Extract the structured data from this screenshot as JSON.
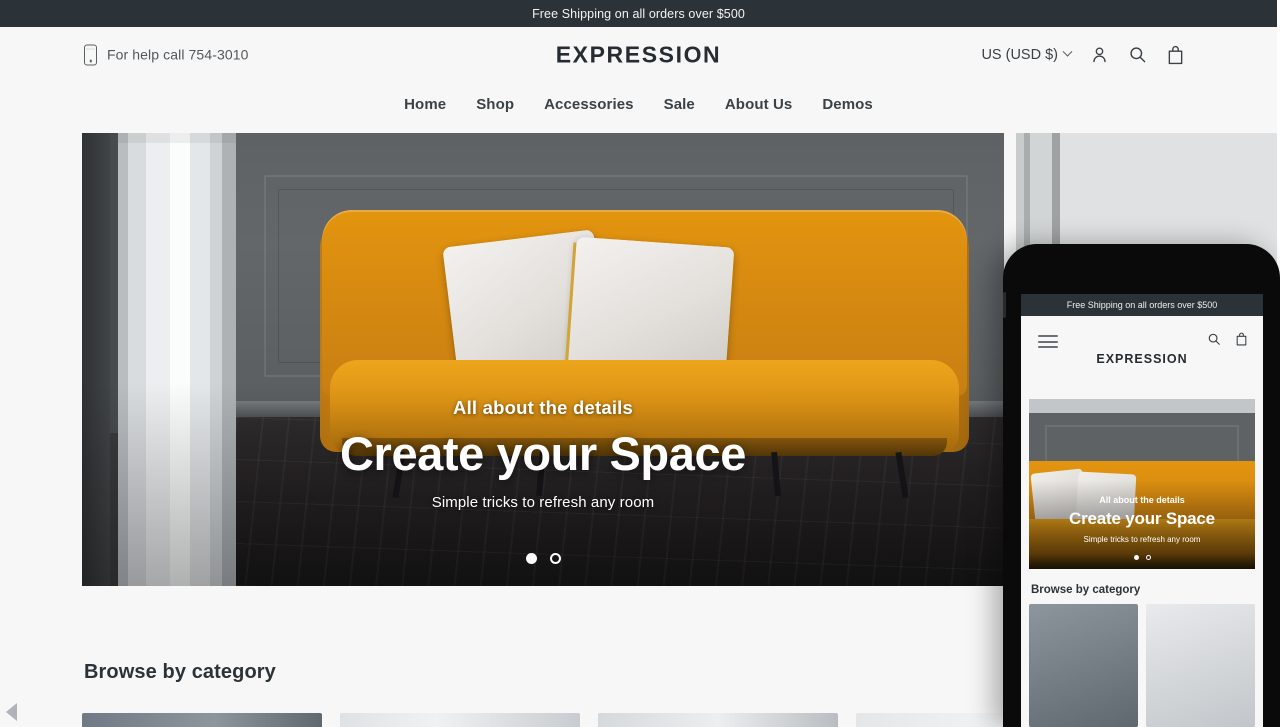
{
  "announcement": {
    "text": "Free Shipping on all orders over $500"
  },
  "header": {
    "help_text": "For help call 754-3010",
    "brand": "EXPRESSION",
    "currency": "US (USD $)",
    "icons": {
      "phone": "phone-icon",
      "chevron": "chevron-down-icon",
      "account": "account-icon",
      "search": "search-icon",
      "cart": "cart-icon"
    }
  },
  "nav": {
    "items": [
      {
        "label": "Home"
      },
      {
        "label": "Shop"
      },
      {
        "label": "Accessories"
      },
      {
        "label": "Sale"
      },
      {
        "label": "About Us"
      },
      {
        "label": "Demos"
      }
    ]
  },
  "hero": {
    "eyebrow": "All about the details",
    "title": "Create your Space",
    "subtitle": "Simple tricks to refresh any room",
    "slides_total": 2,
    "active_slide": 1
  },
  "browse": {
    "title": "Browse by category"
  },
  "mobile": {
    "announcement": "Free Shipping on all orders over $500",
    "brand": "EXPRESSION",
    "hero": {
      "eyebrow": "All about the details",
      "title": "Create your Space",
      "subtitle": "Simple tricks to refresh any room"
    },
    "browse_title": "Browse by category"
  },
  "colors": {
    "announce_bg": "#2c3338",
    "page_bg": "#f7f7f7",
    "text_dark": "#2c3338",
    "accent_sofa": "#dd8e0f",
    "device_frame": "#0a0a0a"
  }
}
